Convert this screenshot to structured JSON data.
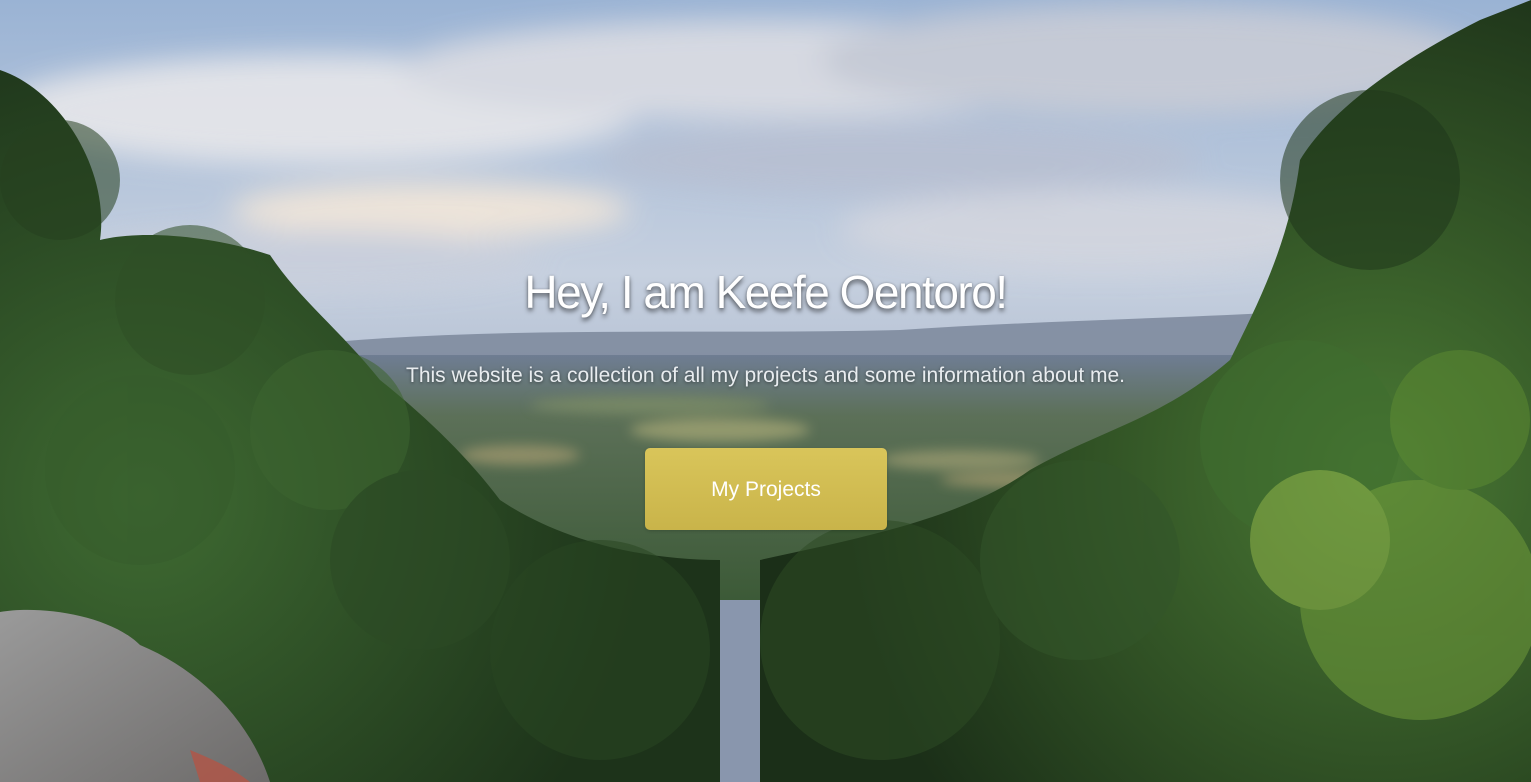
{
  "hero": {
    "title": "Hey, I am Keefe Oentoro!",
    "subtitle": "This website is a collection of all my projects and some information about me.",
    "button_label": "My Projects",
    "background": "mountain-forest-landscape-photo"
  },
  "colors": {
    "button_accent": "#d4c257",
    "title_text": "#ffffff",
    "subtitle_text": "#e8ecef"
  }
}
